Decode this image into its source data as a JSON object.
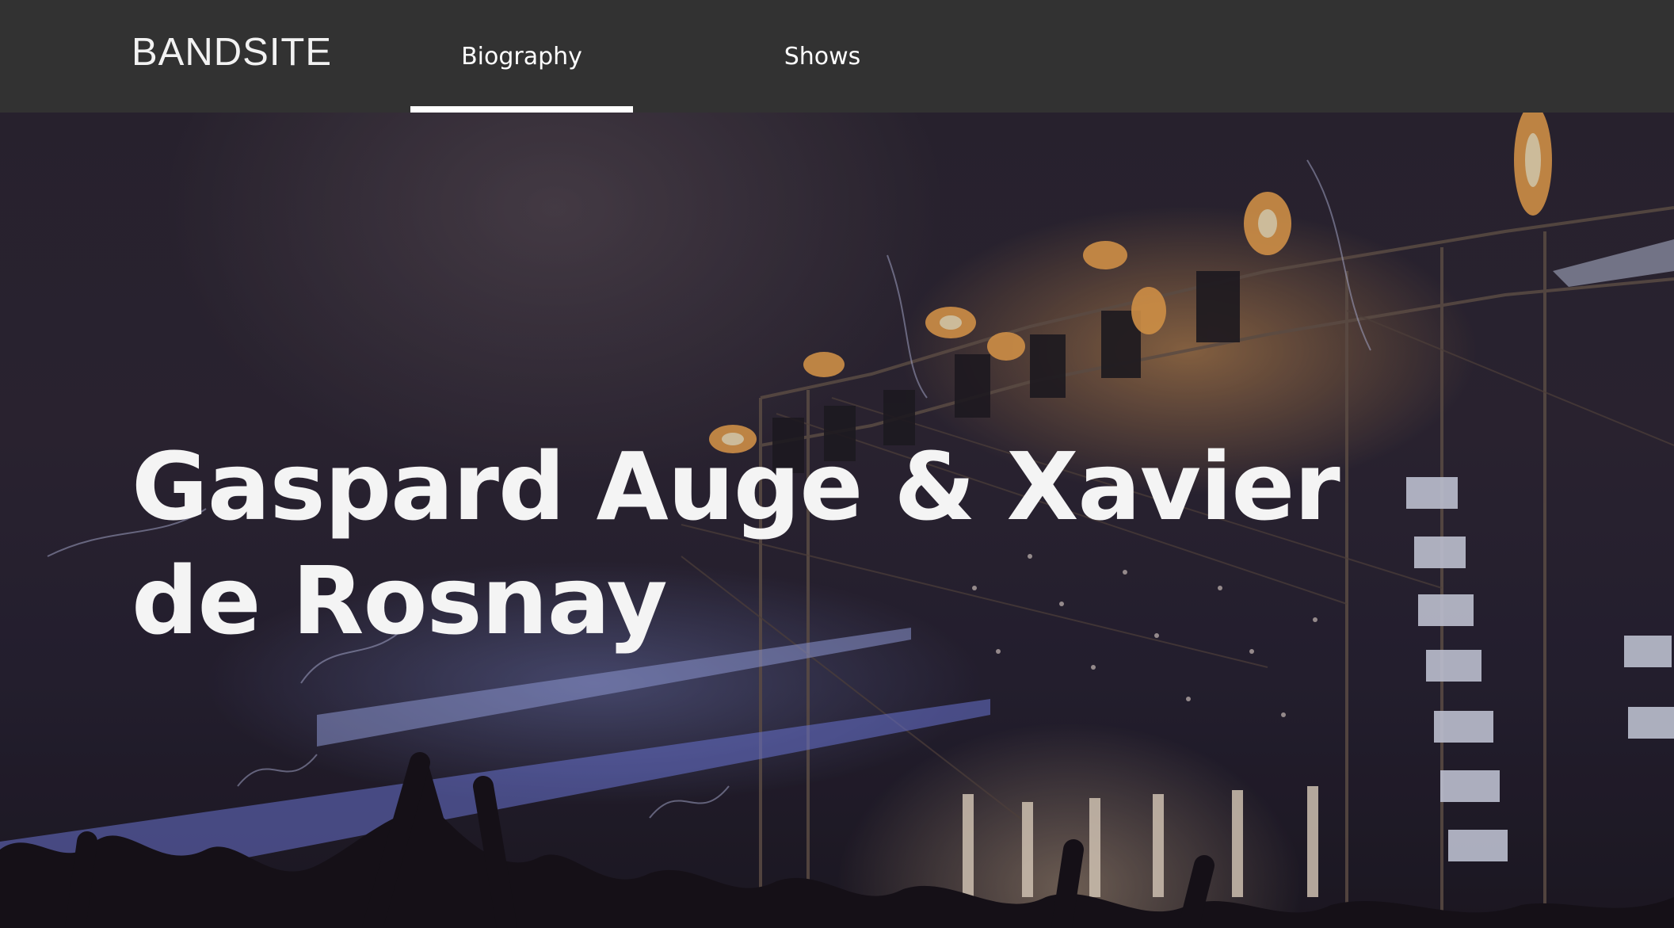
{
  "header": {
    "logo": "BANDSITE",
    "nav": [
      {
        "label": "Biography",
        "active": true
      },
      {
        "label": "Shows",
        "active": false
      }
    ]
  },
  "hero": {
    "title": "Gaspard Auge & Xavier de Rosnay",
    "image": "concert-stage-photo"
  },
  "colors": {
    "header_bg": "#323232",
    "text": "#ffffff",
    "active_indicator": "#ffffff"
  }
}
